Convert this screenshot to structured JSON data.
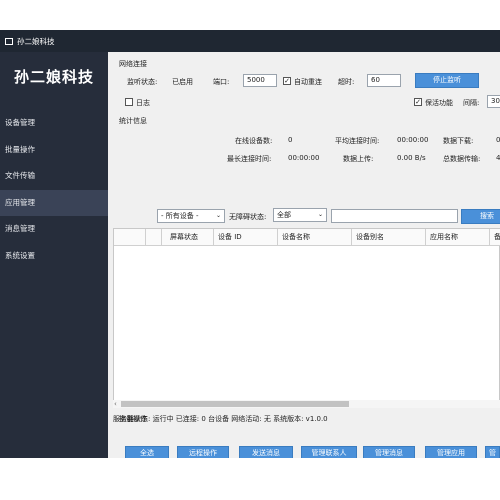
{
  "window": {
    "title": "孙二娘科技"
  },
  "sidebar": {
    "brand": "孙二娘科技",
    "items": [
      "设备管理",
      "批量操作",
      "文件传输",
      "应用管理",
      "消息管理",
      "系统设置"
    ],
    "active_index": 3
  },
  "network": {
    "section_title": "网络连接",
    "listen_status_label": "监听状态:",
    "listen_status_value": "已启用",
    "port_label": "端口:",
    "port_value": "5000",
    "auto_reconnect_label": "自动重连",
    "auto_reconnect_checked": true,
    "timeout_label": "超时:",
    "timeout_value": "60",
    "stop_button": "停止监听",
    "log_label": "日志",
    "log_checked": false,
    "keepalive_label": "保活功能",
    "keepalive_checked": true,
    "interval_label": "间隔:",
    "interval_value": "30"
  },
  "stats": {
    "section_title": "统计信息",
    "online_label": "在线设备数:",
    "online_value": "0",
    "avg_time_label": "平均连接时间:",
    "avg_time_value": "00:00:00",
    "download_label": "数据下载:",
    "download_value": "0",
    "max_time_label": "最长连接时间:",
    "max_time_value": "00:00:00",
    "upload_label": "数据上传:",
    "upload_value": "0.00 B/s",
    "total_label": "总数据传输:",
    "total_value": "4"
  },
  "filter": {
    "device_select": "- 所有设备 -",
    "barrier_label": "无障碍状态:",
    "barrier_select": "全部",
    "search_placeholder": "",
    "search_button": "搜索"
  },
  "table": {
    "columns": [
      "",
      "",
      "屏幕状态",
      "设备 ID",
      "设备名称",
      "设备别名",
      "应用名称",
      "备"
    ]
  },
  "batch": {
    "section_title": "批量操作",
    "buttons": [
      "全选",
      "远程操作",
      "发送消息",
      "管理联系人",
      "管理消息",
      "管理应用",
      "管"
    ]
  },
  "status_bar": {
    "text": "服务器状态: 运行中  已连接: 0 台设备  网络活动: 无  系统版本: v1.0.0"
  },
  "colors": {
    "sidebar_bg": "#262d3b",
    "titlebar_bg": "#1f2732",
    "button_blue": "#4a90d9",
    "window_bg": "#f0f0f0"
  }
}
